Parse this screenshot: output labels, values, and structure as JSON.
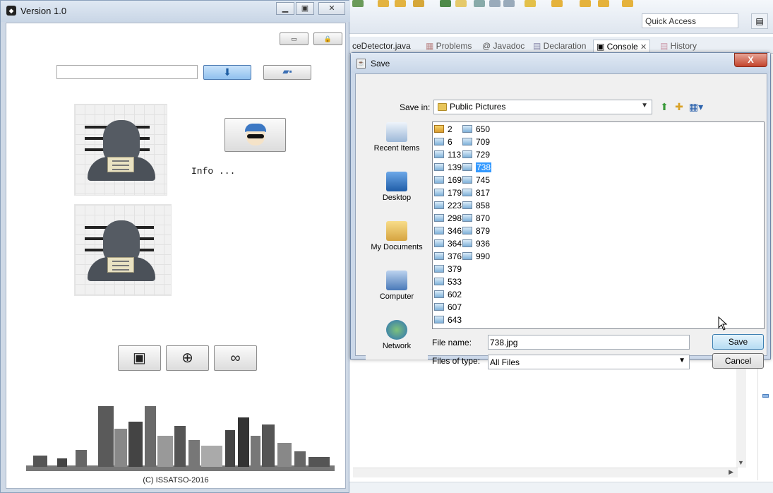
{
  "app": {
    "title": "Version 1.0",
    "info_label": "Info ...",
    "copyright": "(C) ISSATSO-2016"
  },
  "eclipse": {
    "quick_access": "Quick Access",
    "tabs": [
      "ceDetector.java",
      "Problems",
      "@ Javadoc",
      "Declaration",
      "Console",
      "History"
    ],
    "active_tab": "Console",
    "tab_close": "✕"
  },
  "dialog": {
    "title": "Save",
    "save_in_label": "Save in:",
    "save_in_value": "Public Pictures",
    "places": [
      "Recent Items",
      "Desktop",
      "My Documents",
      "Computer",
      "Network"
    ],
    "files_col1": [
      "2",
      "6",
      "113",
      "139",
      "169",
      "179",
      "223",
      "298",
      "346",
      "364",
      "376",
      "379",
      "533",
      "602",
      "607",
      "643"
    ],
    "files_col2": [
      "650",
      "709",
      "729",
      "738",
      "745",
      "817",
      "858",
      "870",
      "879",
      "936",
      "990"
    ],
    "selected_file": "738",
    "file_name_label": "File name:",
    "file_name_value": "738.jpg",
    "file_type_label": "Files of type:",
    "file_type_value": "All Files",
    "save_button": "Save",
    "cancel_button": "Cancel",
    "close_glyph": "X"
  },
  "colors": {
    "selection": "#3399ff",
    "dialog_frame": "#cbd8e9",
    "close_button": "#c3442c"
  }
}
